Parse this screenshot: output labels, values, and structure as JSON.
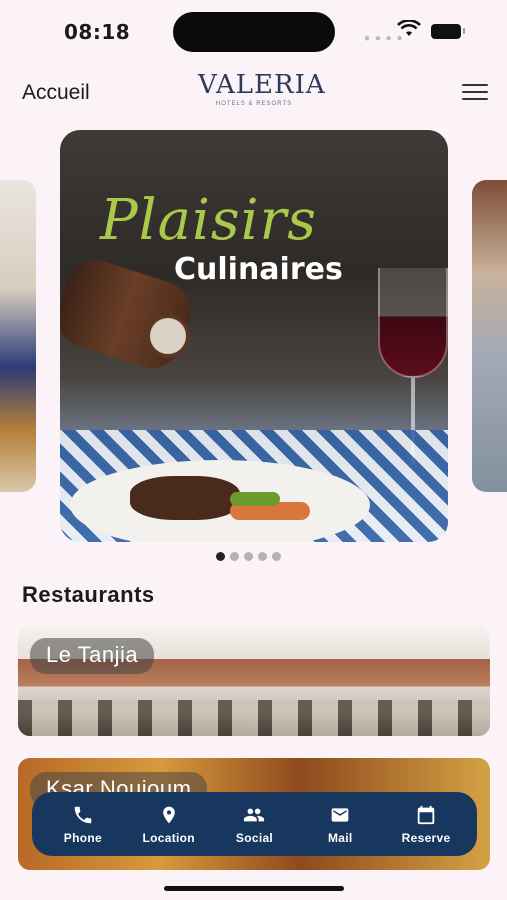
{
  "status_bar": {
    "time": "08:18"
  },
  "header": {
    "back_label": "Accueil",
    "logo_text": "VALERIA",
    "logo_subtitle": "HOTELS & RESORTS"
  },
  "carousel": {
    "hero_title_script": "Plaisirs",
    "hero_title_main": "Culinaires",
    "slide_count": 5,
    "active_index": 0
  },
  "restaurants": {
    "section_title": "Restaurants",
    "items": [
      {
        "name": "Le Tanjia"
      },
      {
        "name": "Ksar Noujoum"
      }
    ]
  },
  "bottom_nav": {
    "items": [
      {
        "label": "Phone",
        "icon": "phone-icon"
      },
      {
        "label": "Location",
        "icon": "location-icon"
      },
      {
        "label": "Social",
        "icon": "people-icon"
      },
      {
        "label": "Mail",
        "icon": "mail-icon"
      },
      {
        "label": "Reserve",
        "icon": "calendar-icon"
      }
    ]
  },
  "colors": {
    "background": "#fbf3f8",
    "nav_bar": "#18375e",
    "script_green": "#a8c94a",
    "logo_navy": "#2d3b5c"
  }
}
